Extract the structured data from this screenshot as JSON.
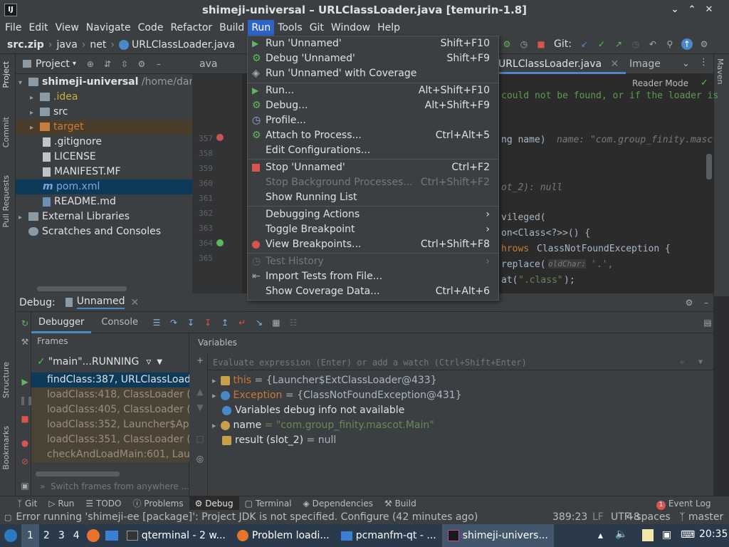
{
  "window": {
    "title": "shimeji-universal – URLClassLoader.java [temurin-1.8]"
  },
  "menubar": [
    "File",
    "Edit",
    "View",
    "Navigate",
    "Code",
    "Refactor",
    "Build",
    "Run",
    "Tools",
    "Git",
    "Window",
    "Help"
  ],
  "breadcrumb": {
    "zip": "src.zip",
    "parts": [
      "java",
      "net"
    ],
    "file": "URLClassLoader.java"
  },
  "toolbar": {
    "git_label": "Git:"
  },
  "sidebar_left": [
    "Project",
    "Commit",
    "Pull Requests",
    "Structure",
    "Bookmarks"
  ],
  "sidebar_right": [
    "Maven"
  ],
  "project": {
    "header": "Project",
    "root": "shimeji-universal",
    "root_path": "/home/dartz",
    "items": [
      ".idea",
      "src",
      "target",
      ".gitignore",
      "LICENSE",
      "MANIFEST.MF",
      "pom.xml",
      "README.md",
      "External Libraries",
      "Scratches and Consoles"
    ]
  },
  "editor": {
    "tabs": [
      "ava",
      "URLClassLoader.java",
      "Image"
    ],
    "reader_mode": "Reader Mode",
    "lines": [
      "357",
      "358",
      "359",
      "360",
      "361",
      "362",
      "363",
      "364",
      "365"
    ],
    "code": {
      "c1": "could not be found, or if the loader is",
      "c2a": "ng name)",
      "c2b": "name: \"com.group_finity.masc",
      "c3": "ot_2): null",
      "c4": "vileged(",
      "c5": "on<Class<?>>() {",
      "c6a": "hrows",
      "c6b": "ClassNotFoundException {",
      "c7a": "replace(",
      "c7b": "oldChar:",
      "c7c": "'.',",
      "c8a": "at(",
      "c8b": "\".class\"",
      "c8c": ");"
    }
  },
  "run_menu": {
    "items": [
      {
        "label": "Run 'Unnamed'",
        "shortcut": "Shift+F10",
        "icon": "run-icon"
      },
      {
        "label": "Debug 'Unnamed'",
        "shortcut": "Shift+F9",
        "icon": "debug-icon"
      },
      {
        "label": "Run 'Unnamed' with Coverage",
        "shortcut": "",
        "icon": "coverage-icon"
      },
      {
        "label": "Run...",
        "shortcut": "Alt+Shift+F10",
        "icon": "run-icon"
      },
      {
        "label": "Debug...",
        "shortcut": "Alt+Shift+F9",
        "icon": "debug-icon"
      },
      {
        "label": "Profile...",
        "shortcut": "",
        "icon": "profile-icon"
      },
      {
        "label": "Attach to Process...",
        "shortcut": "Ctrl+Alt+5",
        "icon": "attach-icon"
      },
      {
        "label": "Edit Configurations...",
        "shortcut": "",
        "icon": ""
      },
      {
        "label": "Stop 'Unnamed'",
        "shortcut": "Ctrl+F2",
        "icon": "stop-icon"
      },
      {
        "label": "Stop Background Processes...",
        "shortcut": "Ctrl+Shift+F2",
        "icon": ""
      },
      {
        "label": "Show Running List",
        "shortcut": "",
        "icon": ""
      },
      {
        "label": "Debugging Actions",
        "shortcut": "",
        "icon": ""
      },
      {
        "label": "Toggle Breakpoint",
        "shortcut": "",
        "icon": ""
      },
      {
        "label": "View Breakpoints...",
        "shortcut": "Ctrl+Shift+F8",
        "icon": "breakpoint-icon"
      },
      {
        "label": "Test History",
        "shortcut": "",
        "icon": "history-icon"
      },
      {
        "label": "Import Tests from File...",
        "shortcut": "",
        "icon": "import-icon"
      },
      {
        "label": "Show Coverage Data...",
        "shortcut": "Ctrl+Alt+6",
        "icon": ""
      }
    ]
  },
  "debug": {
    "title": "Debug:",
    "config": "Unnamed",
    "tabs": [
      "Debugger",
      "Console"
    ],
    "frames_header": "Frames",
    "variables_header": "Variables",
    "thread": "\"main\"...RUNNING",
    "frames": [
      "findClass:387, URLClassLoader",
      "loadClass:418, ClassLoader (ja",
      "loadClass:405, ClassLoader (ja",
      "loadClass:352, Launcher$AppC",
      "loadClass:351, ClassLoader (ja",
      "checkAndLoadMain:601, Launc"
    ],
    "switch_hint": "Switch frames from anywhere ...",
    "eval_placeholder": "Evaluate expression (Enter) or add a watch (Ctrl+Shift+Enter)",
    "vars": [
      {
        "name": "this",
        "value": "= {Launcher$ExtClassLoader@433}"
      },
      {
        "name": "Exception",
        "value": "= {ClassNotFoundException@431}"
      },
      {
        "name": "Variables debug info not available",
        "value": ""
      },
      {
        "name": "name",
        "value": "= \"com.group_finity.mascot.Main\""
      },
      {
        "name": "result (slot_2)",
        "value": "= null"
      }
    ]
  },
  "bottom_tabs": [
    "Git",
    "Run",
    "TODO",
    "Problems",
    "Debug",
    "Terminal",
    "Dependencies",
    "Build"
  ],
  "event_log": {
    "label": "Event Log",
    "count": "1"
  },
  "status": {
    "message": "Error running 'shimeji-ee [package]': Project JDK is not specified. Configure (42 minutes ago)",
    "position": "389:23",
    "line_sep": "LF",
    "encoding": "UTF-8",
    "indent": "4 spaces",
    "branch": "master"
  },
  "taskbar": {
    "desktops": [
      "1",
      "2",
      "3",
      "4"
    ],
    "tasks": [
      "qterminal - 2 w...",
      "Problem loadi...",
      "pcmanfm-qt - ...",
      "shimeji-univers..."
    ],
    "clock": "20:35"
  }
}
